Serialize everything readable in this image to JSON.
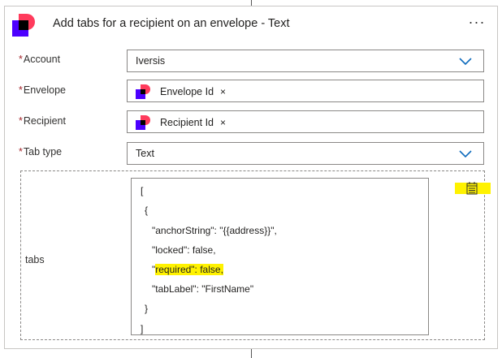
{
  "header": {
    "title": "Add tabs for a recipient on an envelope - Text",
    "more_label": "···"
  },
  "fields": {
    "account": {
      "label": "Account",
      "required": "*",
      "value": "Iversis"
    },
    "envelope": {
      "label": "Envelope",
      "required": "*",
      "token": "Envelope Id",
      "remove": "×"
    },
    "recipient": {
      "label": "Recipient",
      "required": "*",
      "token": "Recipient Id",
      "remove": "×"
    },
    "tab_type": {
      "label": "Tab type",
      "required": "*",
      "value": "Text"
    }
  },
  "tabs": {
    "label": "tabs",
    "json_lines": [
      "[",
      "{",
      "\"anchorString\": \"{{address}}\",",
      "\"locked\": false,",
      "\"required\": false,",
      "\"tabLabel\": \"FirstName\"",
      "}",
      "]"
    ],
    "required_line": {
      "prefix": "\"",
      "highlighted": "required\": false,"
    }
  },
  "colors": {
    "brand_red": "#ff3b5c",
    "brand_purple": "#4c00ff",
    "accent_blue": "#0f6cbd",
    "highlight": "#fff200"
  }
}
